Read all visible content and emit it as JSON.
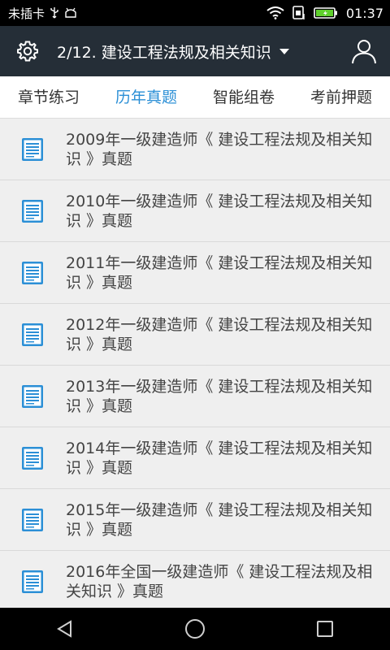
{
  "status_bar": {
    "carrier": "未插卡",
    "time": "01:37"
  },
  "app_bar": {
    "title": "2/12. 建设工程法规及相关知识"
  },
  "tabs": [
    {
      "label": "章节练习",
      "active": false
    },
    {
      "label": "历年真题",
      "active": true
    },
    {
      "label": "智能组卷",
      "active": false
    },
    {
      "label": "考前押题",
      "active": false
    }
  ],
  "items": [
    {
      "title": "2009年一级建造师《 建设工程法规及相关知识 》真题"
    },
    {
      "title": "2010年一级建造师《 建设工程法规及相关知识 》真题"
    },
    {
      "title": "2011年一级建造师《 建设工程法规及相关知识 》真题"
    },
    {
      "title": "2012年一级建造师《 建设工程法规及相关知识 》真题"
    },
    {
      "title": "2013年一级建造师《 建设工程法规及相关知识 》真题"
    },
    {
      "title": "2014年一级建造师《 建设工程法规及相关知识 》真题"
    },
    {
      "title": "2015年一级建造师《 建设工程法规及相关知识 》真题"
    },
    {
      "title": "2016年全国一级建造师《 建设工程法规及相关知识 》真题"
    }
  ],
  "colors": {
    "app_bar": "#252e37",
    "accent": "#2b8fd6",
    "list_bg": "#efefef"
  },
  "icons": {
    "settings": "gear-icon",
    "account": "user-icon",
    "list_item": "document-icon"
  }
}
